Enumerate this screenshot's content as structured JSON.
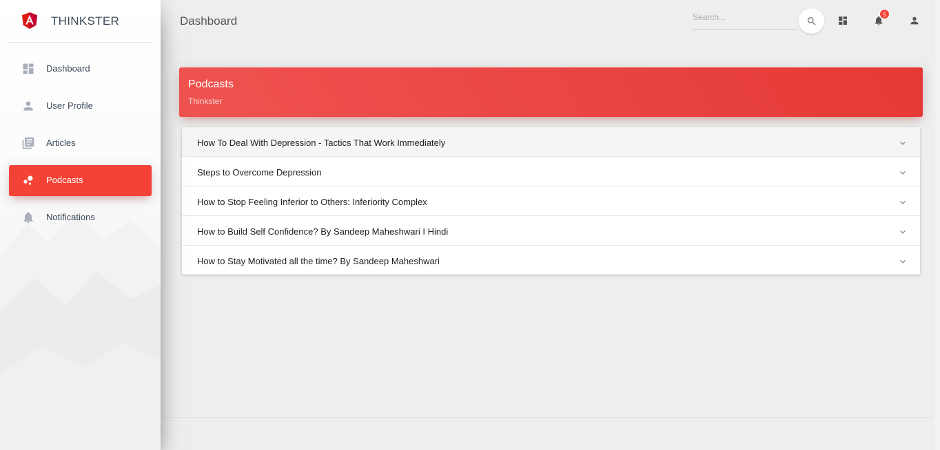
{
  "brand": {
    "name": "THINKSTER",
    "logo_icon": "angular-shield-icon",
    "accent": "#f44336"
  },
  "sidebar": {
    "items": [
      {
        "label": "Dashboard",
        "icon": "dashboard-icon",
        "active": false
      },
      {
        "label": "User Profile",
        "icon": "person-icon",
        "active": false
      },
      {
        "label": "Articles",
        "icon": "library-books-icon",
        "active": false
      },
      {
        "label": "Podcasts",
        "icon": "bubble-chart-icon",
        "active": true
      },
      {
        "label": "Notifications",
        "icon": "bell-icon",
        "active": false
      }
    ]
  },
  "topbar": {
    "title": "Dashboard",
    "search_placeholder": "Search...",
    "notification_count": "5"
  },
  "card": {
    "title": "Podcasts",
    "subtitle": "Thinkster"
  },
  "podcasts": [
    "How To Deal With Depression - Tactics That Work Immediately",
    "Steps to Overcome Depression",
    "How to Stop Feeling Inferior to Others: Inferiority Complex",
    "How to Build Self Confidence? By Sandeep Maheshwari I Hindi",
    "How to Stay Motivated all the time? By Sandeep Maheshwari"
  ]
}
